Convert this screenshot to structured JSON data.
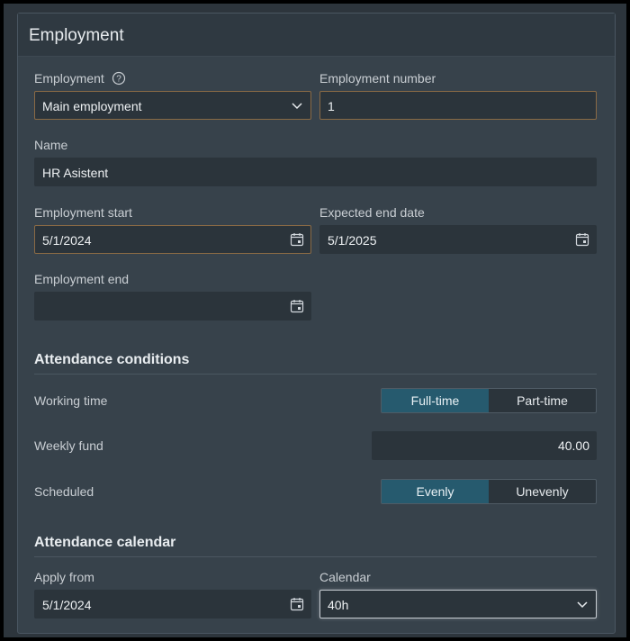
{
  "panel": {
    "title": "Employment"
  },
  "employment": {
    "label": "Employment",
    "value": "Main employment",
    "number_label": "Employment number",
    "number_value": "1"
  },
  "name": {
    "label": "Name",
    "value": "HR Asistent"
  },
  "dates": {
    "start_label": "Employment start",
    "start_value": "5/1/2024",
    "expected_end_label": "Expected end date",
    "expected_end_value": "5/1/2025",
    "end_label": "Employment end",
    "end_value": ""
  },
  "attendance": {
    "title": "Attendance conditions",
    "working_time_label": "Working time",
    "working_time_options": [
      "Full-time",
      "Part-time"
    ],
    "working_time_selected": "Full-time",
    "weekly_fund_label": "Weekly fund",
    "weekly_fund_value": "40.00",
    "scheduled_label": "Scheduled",
    "scheduled_options": [
      "Evenly",
      "Unevenly"
    ],
    "scheduled_selected": "Evenly"
  },
  "calendar": {
    "title": "Attendance calendar",
    "apply_from_label": "Apply from",
    "apply_from_value": "5/1/2024",
    "calendar_label": "Calendar",
    "calendar_value": "40h"
  },
  "icons": {
    "help": "help-circle-icon",
    "calendar": "calendar-icon",
    "chevron": "chevron-down-icon"
  },
  "colors": {
    "background": "#37424b",
    "header": "#2f3941",
    "field": "#2b343b",
    "active_segment": "#265a6e",
    "focus_border": "#8a6a45"
  }
}
